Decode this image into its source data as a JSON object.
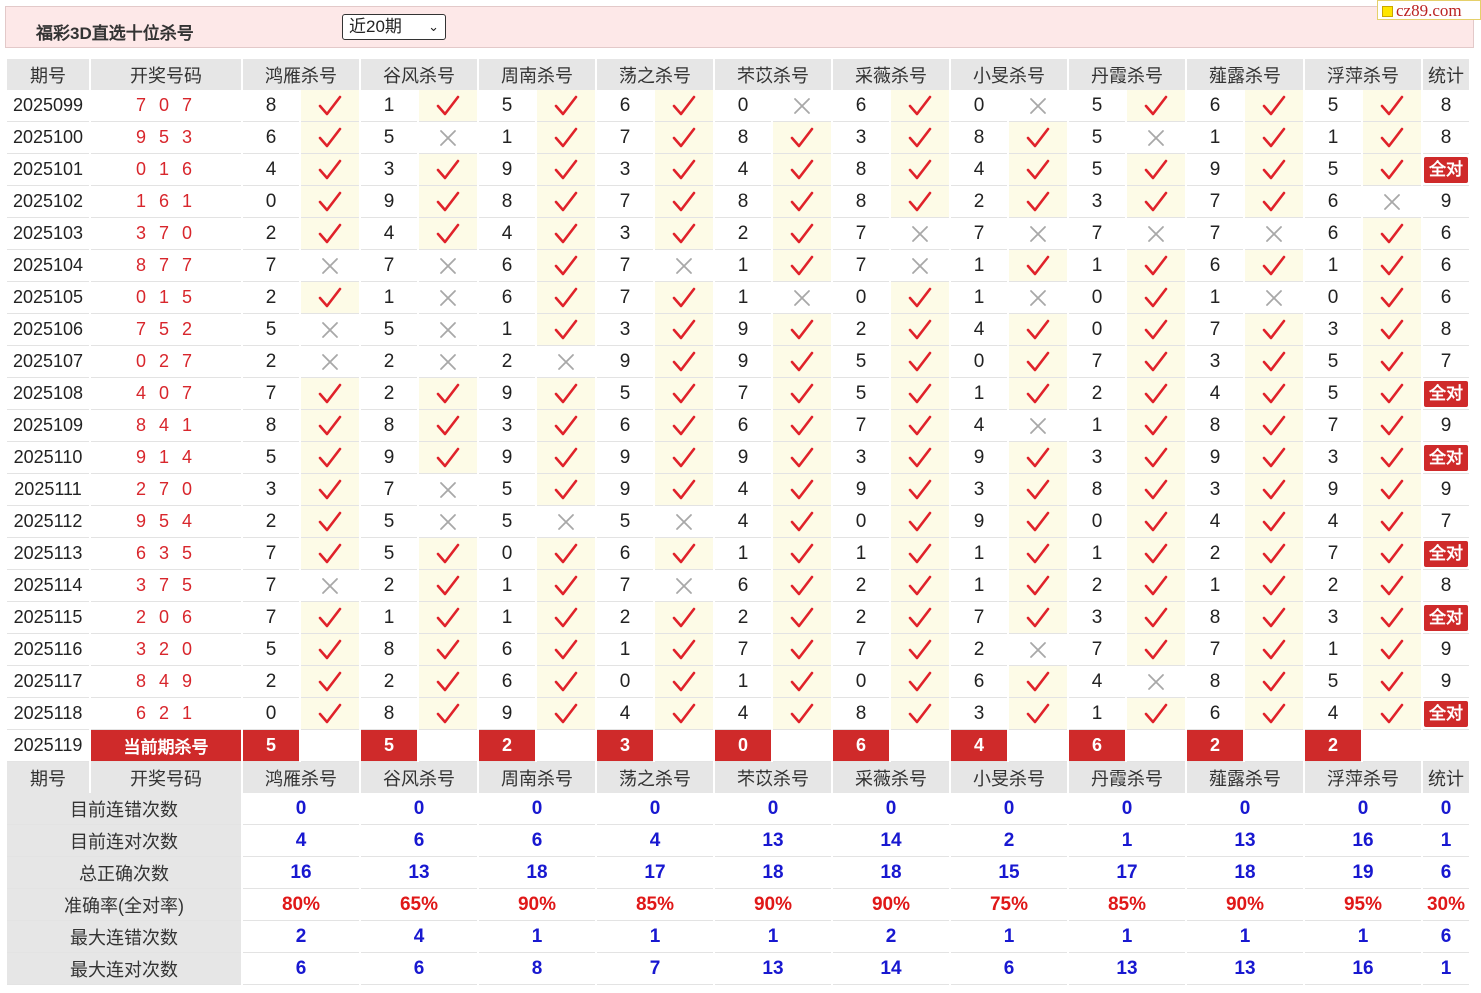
{
  "header": {
    "title": "福彩3D直选十位杀号",
    "period_select": "近20期",
    "logo_text": "cz89.com"
  },
  "columns": {
    "issue": "期号",
    "draw": "开奖号码",
    "experts": [
      "鸿雁杀号",
      "谷风杀号",
      "周南杀号",
      "荡之杀号",
      "芣苡杀号",
      "采薇杀号",
      "小旻杀号",
      "丹霞杀号",
      "薤露杀号",
      "浮萍杀号"
    ],
    "stat": "统计"
  },
  "rows": [
    {
      "issue": "2025099",
      "draw": "7 0 7",
      "kills": [
        8,
        1,
        5,
        6,
        0,
        6,
        0,
        5,
        6,
        5
      ],
      "ok": [
        1,
        1,
        1,
        1,
        0,
        1,
        0,
        1,
        1,
        1
      ],
      "stat": "8"
    },
    {
      "issue": "2025100",
      "draw": "9 5 3",
      "kills": [
        6,
        5,
        1,
        7,
        8,
        3,
        8,
        5,
        1,
        1
      ],
      "ok": [
        1,
        0,
        1,
        1,
        1,
        1,
        1,
        0,
        1,
        1
      ],
      "stat": "8"
    },
    {
      "issue": "2025101",
      "draw": "0 1 6",
      "kills": [
        4,
        3,
        9,
        3,
        4,
        8,
        4,
        5,
        9,
        5
      ],
      "ok": [
        1,
        1,
        1,
        1,
        1,
        1,
        1,
        1,
        1,
        1
      ],
      "stat": "全对"
    },
    {
      "issue": "2025102",
      "draw": "1 6 1",
      "kills": [
        0,
        9,
        8,
        7,
        8,
        8,
        2,
        3,
        7,
        6
      ],
      "ok": [
        1,
        1,
        1,
        1,
        1,
        1,
        1,
        1,
        1,
        0
      ],
      "stat": "9"
    },
    {
      "issue": "2025103",
      "draw": "3 7 0",
      "kills": [
        2,
        4,
        4,
        3,
        2,
        7,
        7,
        7,
        7,
        6
      ],
      "ok": [
        1,
        1,
        1,
        1,
        1,
        0,
        0,
        0,
        0,
        1
      ],
      "stat": "6"
    },
    {
      "issue": "2025104",
      "draw": "8 7 7",
      "kills": [
        7,
        7,
        6,
        7,
        1,
        7,
        1,
        1,
        6,
        1
      ],
      "ok": [
        0,
        0,
        1,
        0,
        1,
        0,
        1,
        1,
        1,
        1
      ],
      "stat": "6"
    },
    {
      "issue": "2025105",
      "draw": "0 1 5",
      "kills": [
        2,
        1,
        6,
        7,
        1,
        0,
        1,
        0,
        1,
        0
      ],
      "ok": [
        1,
        0,
        1,
        1,
        0,
        1,
        0,
        1,
        0,
        1
      ],
      "stat": "6"
    },
    {
      "issue": "2025106",
      "draw": "7 5 2",
      "kills": [
        5,
        5,
        1,
        3,
        9,
        2,
        4,
        0,
        7,
        3
      ],
      "ok": [
        0,
        0,
        1,
        1,
        1,
        1,
        1,
        1,
        1,
        1
      ],
      "stat": "8"
    },
    {
      "issue": "2025107",
      "draw": "0 2 7",
      "kills": [
        2,
        2,
        2,
        9,
        9,
        5,
        0,
        7,
        3,
        5
      ],
      "ok": [
        0,
        0,
        0,
        1,
        1,
        1,
        1,
        1,
        1,
        1
      ],
      "stat": "7"
    },
    {
      "issue": "2025108",
      "draw": "4 0 7",
      "kills": [
        7,
        2,
        9,
        5,
        7,
        5,
        1,
        2,
        4,
        5
      ],
      "ok": [
        1,
        1,
        1,
        1,
        1,
        1,
        1,
        1,
        1,
        1
      ],
      "stat": "全对"
    },
    {
      "issue": "2025109",
      "draw": "8 4 1",
      "kills": [
        8,
        8,
        3,
        6,
        6,
        7,
        4,
        1,
        8,
        7
      ],
      "ok": [
        1,
        1,
        1,
        1,
        1,
        1,
        0,
        1,
        1,
        1
      ],
      "stat": "9"
    },
    {
      "issue": "2025110",
      "draw": "9 1 4",
      "kills": [
        5,
        9,
        9,
        9,
        9,
        3,
        9,
        3,
        9,
        3
      ],
      "ok": [
        1,
        1,
        1,
        1,
        1,
        1,
        1,
        1,
        1,
        1
      ],
      "stat": "全对"
    },
    {
      "issue": "2025111",
      "draw": "2 7 0",
      "kills": [
        3,
        7,
        5,
        9,
        4,
        9,
        3,
        8,
        3,
        9
      ],
      "ok": [
        1,
        0,
        1,
        1,
        1,
        1,
        1,
        1,
        1,
        1
      ],
      "stat": "9"
    },
    {
      "issue": "2025112",
      "draw": "9 5 4",
      "kills": [
        2,
        5,
        5,
        5,
        4,
        0,
        9,
        0,
        4,
        4
      ],
      "ok": [
        1,
        0,
        0,
        0,
        1,
        1,
        1,
        1,
        1,
        1
      ],
      "stat": "7"
    },
    {
      "issue": "2025113",
      "draw": "6 3 5",
      "kills": [
        7,
        5,
        0,
        6,
        1,
        1,
        1,
        1,
        2,
        7
      ],
      "ok": [
        1,
        1,
        1,
        1,
        1,
        1,
        1,
        1,
        1,
        1
      ],
      "stat": "全对"
    },
    {
      "issue": "2025114",
      "draw": "3 7 5",
      "kills": [
        7,
        2,
        1,
        7,
        6,
        2,
        1,
        2,
        1,
        2
      ],
      "ok": [
        0,
        1,
        1,
        0,
        1,
        1,
        1,
        1,
        1,
        1
      ],
      "stat": "8"
    },
    {
      "issue": "2025115",
      "draw": "2 0 6",
      "kills": [
        7,
        1,
        1,
        2,
        2,
        2,
        7,
        3,
        8,
        3
      ],
      "ok": [
        1,
        1,
        1,
        1,
        1,
        1,
        1,
        1,
        1,
        1
      ],
      "stat": "全对"
    },
    {
      "issue": "2025116",
      "draw": "3 2 0",
      "kills": [
        5,
        8,
        6,
        1,
        7,
        7,
        2,
        7,
        7,
        1
      ],
      "ok": [
        1,
        1,
        1,
        1,
        1,
        1,
        0,
        1,
        1,
        1
      ],
      "stat": "9"
    },
    {
      "issue": "2025117",
      "draw": "8 4 9",
      "kills": [
        2,
        2,
        6,
        0,
        1,
        0,
        6,
        4,
        8,
        5
      ],
      "ok": [
        1,
        1,
        1,
        1,
        1,
        1,
        1,
        0,
        1,
        1
      ],
      "stat": "9"
    },
    {
      "issue": "2025118",
      "draw": "6 2 1",
      "kills": [
        0,
        8,
        9,
        4,
        4,
        8,
        3,
        1,
        6,
        4
      ],
      "ok": [
        1,
        1,
        1,
        1,
        1,
        1,
        1,
        1,
        1,
        1
      ],
      "stat": "全对"
    }
  ],
  "current": {
    "issue": "2025119",
    "label": "当前期杀号",
    "kills": [
      5,
      5,
      2,
      3,
      0,
      6,
      4,
      6,
      2,
      2
    ]
  },
  "stats": [
    {
      "label": "目前连错次数",
      "values": [
        "0",
        "0",
        "0",
        "0",
        "0",
        "0",
        "0",
        "0",
        "0",
        "0"
      ],
      "stat": "0",
      "color": "blue"
    },
    {
      "label": "目前连对次数",
      "values": [
        "4",
        "6",
        "6",
        "4",
        "13",
        "14",
        "2",
        "1",
        "13",
        "16"
      ],
      "stat": "1",
      "color": "blue"
    },
    {
      "label": "总正确次数",
      "values": [
        "16",
        "13",
        "18",
        "17",
        "18",
        "18",
        "15",
        "17",
        "18",
        "19"
      ],
      "stat": "6",
      "color": "blue"
    },
    {
      "label": "准确率(全对率)",
      "values": [
        "80%",
        "65%",
        "90%",
        "85%",
        "90%",
        "90%",
        "75%",
        "85%",
        "90%",
        "95%"
      ],
      "stat": "30%",
      "color": "red"
    },
    {
      "label": "最大连错次数",
      "values": [
        "2",
        "4",
        "1",
        "1",
        "1",
        "2",
        "1",
        "1",
        "1",
        "1"
      ],
      "stat": "6",
      "color": "blue"
    },
    {
      "label": "最大连对次数",
      "values": [
        "6",
        "6",
        "8",
        "7",
        "13",
        "14",
        "6",
        "13",
        "13",
        "16"
      ],
      "stat": "1",
      "color": "blue"
    }
  ],
  "colors": {
    "check": "#e0222a",
    "cross": "#a8a8a8",
    "red_bg": "#cf2a2a",
    "stat_blue": "#1818d0",
    "stat_red": "#e01818"
  }
}
